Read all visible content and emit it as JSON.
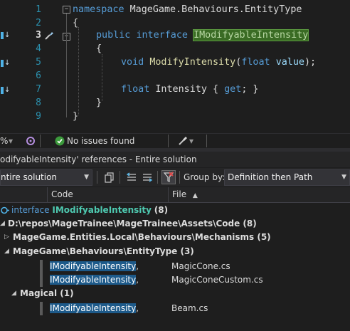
{
  "editor": {
    "lines": [
      {
        "number": "1"
      },
      {
        "number": "2"
      },
      {
        "number": "3"
      },
      {
        "number": "4"
      },
      {
        "number": "5"
      },
      {
        "number": "6"
      },
      {
        "number": "7"
      },
      {
        "number": "8"
      },
      {
        "number": "9"
      }
    ],
    "code": {
      "l1_kw": "namespace",
      "l1_rest": " MageGame.Behaviours.EntityType",
      "l2": "{",
      "l3_kw1": "public",
      "l3_kw2": "interface",
      "l3_name": "IModifyableIntensity",
      "l4": "{",
      "l5_kw": "void",
      "l5_fn": "ModifyIntensity",
      "l5_open": "(",
      "l5_ptype": "float",
      "l5_param": "value",
      "l5_close": ");",
      "l7_kw": "float",
      "l7_name": "Intensity",
      "l7_open": " { ",
      "l7_get": "get",
      "l7_close": "; }",
      "l8": "}",
      "l9": "}"
    }
  },
  "statusbar": {
    "zoom": "%",
    "issues": "No issues found"
  },
  "references": {
    "title": "odifyableIntensity' references - Entire solution",
    "scope": "ntire solution",
    "groupby_label": "Group by:",
    "groupby_value": "Definition then Path",
    "columns": {
      "code": "Code",
      "file": "File"
    },
    "def_kw": "interface",
    "def_name": "IModifyableIntensity",
    "def_count": "(8)",
    "path_node": "D:\\repos\\MageTrainee\\MageTrainee\\Assets\\Code (8)",
    "groups": [
      {
        "label": "MageGame.Entities.Local\\Behaviours\\Mechanisms (5)"
      },
      {
        "label": "MageGame\\Behaviours\\EntityType (3)"
      },
      {
        "label": "Magical (1)"
      }
    ],
    "items": [
      {
        "code": "IModifyableIntensity",
        "suffix": ",",
        "file": "MagicCone.cs"
      },
      {
        "code": "IModifyableIntensity",
        "suffix": ",",
        "file": "MagicConeCustom.cs"
      },
      {
        "code": "IModifyableIntensity",
        "suffix": ",",
        "file": "Beam.cs"
      }
    ]
  }
}
